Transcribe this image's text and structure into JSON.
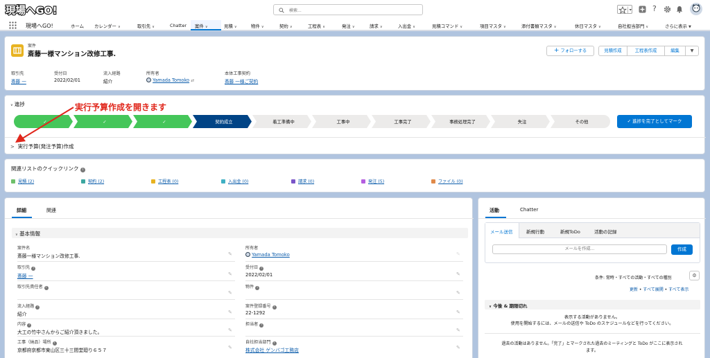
{
  "topbar": {
    "logo_text": "現場へGO!",
    "search_placeholder": "検索..."
  },
  "nav": {
    "app_name": "現場へGO!",
    "items": [
      {
        "label": "ホーム",
        "dropdown": false
      },
      {
        "label": "カレンダー",
        "dropdown": true
      },
      {
        "label": "取引先",
        "dropdown": true
      },
      {
        "label": "Chatter",
        "dropdown": false
      },
      {
        "label": "案件",
        "dropdown": true,
        "selected": true
      },
      {
        "label": "見積",
        "dropdown": true
      },
      {
        "label": "物件",
        "dropdown": true
      },
      {
        "label": "契約",
        "dropdown": true
      },
      {
        "label": "工程表",
        "dropdown": true
      },
      {
        "label": "発注",
        "dropdown": true
      },
      {
        "label": "請求",
        "dropdown": true
      },
      {
        "label": "入出金",
        "dropdown": true
      },
      {
        "label": "見積コマンド",
        "dropdown": true
      },
      {
        "label": "項目マスタ",
        "dropdown": true
      },
      {
        "label": "添付書類マスタ",
        "dropdown": true
      },
      {
        "label": "休日マスタ",
        "dropdown": true
      },
      {
        "label": "自社担当部門",
        "dropdown": true
      },
      {
        "label": "さらに表示",
        "dropdown": true
      }
    ]
  },
  "record": {
    "object_label": "案件",
    "title": "斎藤一様マンション改修工事.",
    "buttons": {
      "follow": "フォローする",
      "quote": "見積作成",
      "schedule": "工程表作成",
      "edit": "編集"
    },
    "highlights": [
      {
        "label": "取引先",
        "value": "斎藤 一",
        "link": true
      },
      {
        "label": "受付日",
        "value": "2022/02/01",
        "link": false
      },
      {
        "label": "流入経路",
        "value": "紹介",
        "link": false
      },
      {
        "label": "所有者",
        "value": "Yamada Tomoko",
        "link": true
      },
      {
        "label": "本体工事契約",
        "value": "斎藤 一様ご契約",
        "link": true
      }
    ]
  },
  "path": {
    "title": "進捗",
    "stages": [
      {
        "label": "",
        "status": "complete"
      },
      {
        "label": "",
        "status": "complete"
      },
      {
        "label": "",
        "status": "complete"
      },
      {
        "label": "契約成立",
        "status": "current"
      },
      {
        "label": "着工準備中",
        "status": "incomplete"
      },
      {
        "label": "工事中",
        "status": "incomplete"
      },
      {
        "label": "工事完了",
        "status": "incomplete"
      },
      {
        "label": "事務処理完了",
        "status": "incomplete"
      },
      {
        "label": "失注",
        "status": "incomplete"
      },
      {
        "label": "その他",
        "status": "incomplete"
      }
    ],
    "mark_button": "進捗を完了としてマーク",
    "collapsible_section": "実行予算(発注予算)作成",
    "annotation": "実行予算作成を開きます",
    "annotation_color": "#e0261b"
  },
  "quicklinks": {
    "title": "関連リストのクイックリンク",
    "items": [
      {
        "label": "見積 (2)",
        "color": "#6ec06b"
      },
      {
        "label": "契約 (2)",
        "color": "#3ca7a0"
      },
      {
        "label": "工程表 (0)",
        "color": "#e8b321"
      },
      {
        "label": "入出金 (0)",
        "color": "#3fb0c4"
      },
      {
        "label": "請求 (0)",
        "color": "#7a55c8"
      },
      {
        "label": "発注 (5)",
        "color": "#b45ee0"
      },
      {
        "label": "ファイル (0)",
        "color": "#e08a4a"
      }
    ]
  },
  "detail": {
    "tabs": [
      "詳細",
      "関連"
    ],
    "section": "基本情報",
    "fields_left": [
      {
        "label": "案件名",
        "value": "斎藤一様マンション改修工事.",
        "link": false,
        "info": false
      },
      {
        "label": "取引先",
        "value": "斎藤 一",
        "link": true,
        "info": true
      },
      {
        "label": "取引先責任者",
        "value": "",
        "link": false,
        "info": true
      },
      {
        "label": "流入経路",
        "value": "紹介",
        "link": false,
        "info": true
      },
      {
        "label": "内容",
        "value": "大工の竹中さんからご紹介頂きました。",
        "link": false,
        "info": true
      },
      {
        "label": "工事（納品）場所",
        "value": "京都府京都市東山区三十三間堂廻り６５７",
        "link": false,
        "info": true
      }
    ],
    "fields_right": [
      {
        "label": "所有者",
        "value": "Yamada Tomoko",
        "link": true,
        "info": false
      },
      {
        "label": "受付日",
        "value": "2022/02/01",
        "link": false,
        "info": true
      },
      {
        "label": "物件",
        "value": "",
        "link": false,
        "info": true
      },
      {
        "label": "案件登録番号",
        "value": "22-1292",
        "link": false,
        "info": true
      },
      {
        "label": "担当者",
        "value": "",
        "link": false,
        "info": true
      },
      {
        "label": "自社担当部門",
        "value": "株式会社 ゲンバゴ工務店",
        "link": true,
        "info": true
      }
    ]
  },
  "activity": {
    "tabs": [
      "活動",
      "Chatter"
    ],
    "subtabs": [
      "メール送信",
      "新規行動",
      "新規ToDo",
      "活動の記録"
    ],
    "email_placeholder": "メールを作成...",
    "compose_button": "作成",
    "filter_text": "条件: 常時・すべての活動・すべての種別",
    "refresh_link": "更新",
    "expand_link": "すべて展開",
    "show_all_link": "すべて表示",
    "upcoming_title": "今後 & 期限切れ",
    "no_activity_1": "表示する活動がありません。",
    "no_activity_2": "使用を開始するには、メールの送信や ToDo のスケジュールなどを行ってください。",
    "past_text_1": "過去の活動はありません。「完了」とマークされた過去のミーティングと ToDo がここに表示され",
    "past_text_2": "ます。"
  }
}
